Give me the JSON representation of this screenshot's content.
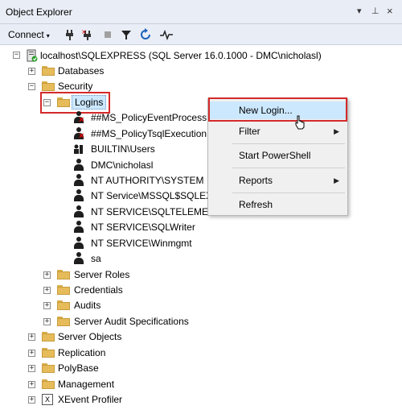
{
  "window": {
    "title": "Object Explorer",
    "controls": [
      "▾",
      "⊥",
      "×"
    ]
  },
  "toolbar": {
    "connect_label": "Connect",
    "icons": [
      "connect-icon",
      "disconnect-icon",
      "stop-icon",
      "filter-icon",
      "refresh-icon",
      "activity-monitor-icon"
    ]
  },
  "tree": {
    "server": "localhost\\SQLEXPRESS (SQL Server 16.0.1000 - DMC\\nicholasl)",
    "databases": "Databases",
    "security": "Security",
    "logins": "Logins",
    "login_items": [
      "##MS_PolicyEventProcess",
      "##MS_PolicyTsqlExecution",
      "BUILTIN\\Users",
      "DMC\\nicholasl",
      "NT AUTHORITY\\SYSTEM",
      "NT Service\\MSSQL$SQLEX",
      "NT SERVICE\\SQLTELEMET",
      "NT SERVICE\\SQLWriter",
      "NT SERVICE\\Winmgmt",
      "sa"
    ],
    "security_children": [
      "Server Roles",
      "Credentials",
      "Audits",
      "Server Audit Specifications"
    ],
    "server_children": [
      "Server Objects",
      "Replication",
      "PolyBase",
      "Management",
      "XEvent Profiler"
    ]
  },
  "context_menu": {
    "new_login": "New Login...",
    "filter": "Filter",
    "start_powershell": "Start PowerShell",
    "reports": "Reports",
    "refresh": "Refresh"
  },
  "colors": {
    "highlight_border": "#d42a2a",
    "menu_hover": "#cce8ff",
    "toolbar_bg": "#e9edf6"
  }
}
